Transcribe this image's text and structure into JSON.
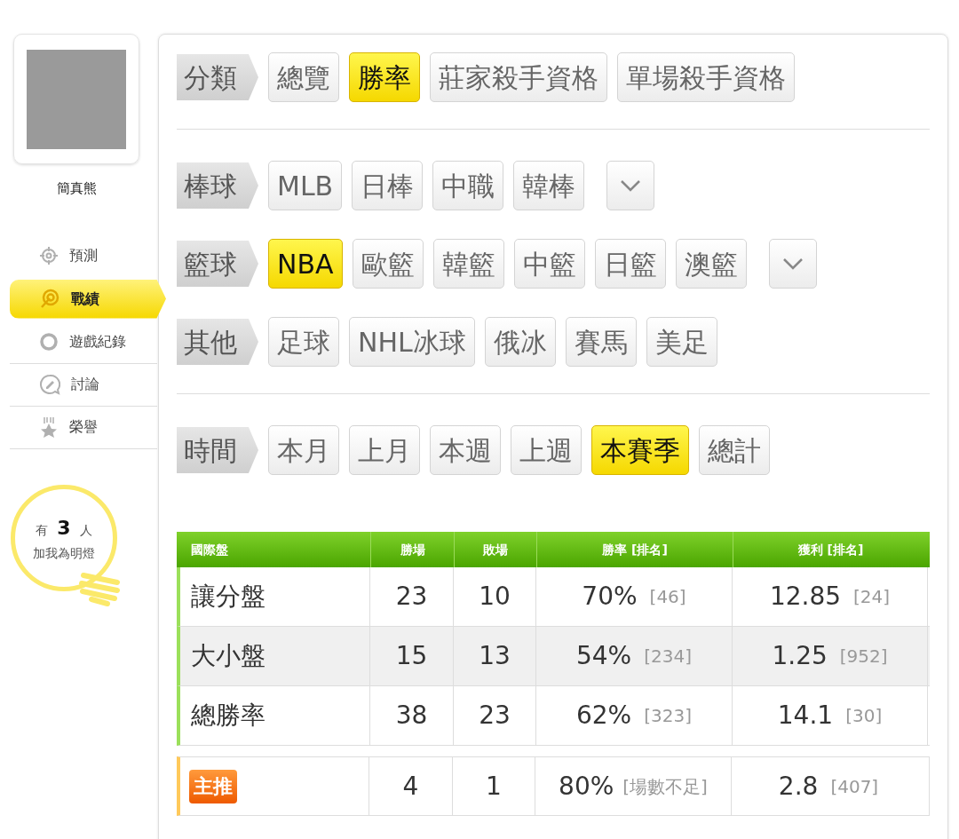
{
  "profile": {
    "name": "簡真熊"
  },
  "nav": [
    {
      "label": "預測",
      "kind": "crosshair",
      "selected": false
    },
    {
      "label": "戰績",
      "kind": "target",
      "selected": true
    },
    {
      "label": "遊戲紀錄",
      "kind": "ring",
      "selected": false
    },
    {
      "label": "討論",
      "kind": "chat",
      "selected": false
    },
    {
      "label": "榮譽",
      "kind": "medal",
      "selected": false
    }
  ],
  "fans": {
    "prefix": "有",
    "count": "3",
    "suffix": "人",
    "text": "加我為明燈"
  },
  "filter_sections": [
    {
      "rows": [
        {
          "label": "分類",
          "has_dropdown": false,
          "options": [
            {
              "label": "總覽",
              "selected": false
            },
            {
              "label": "勝率",
              "selected": true
            },
            {
              "label": "莊家殺手資格",
              "selected": false
            },
            {
              "label": "單場殺手資格",
              "selected": false
            }
          ]
        }
      ]
    },
    {
      "rows": [
        {
          "label": "棒球",
          "has_dropdown": true,
          "options": [
            {
              "label": "MLB",
              "selected": false
            },
            {
              "label": "日棒",
              "selected": false
            },
            {
              "label": "中職",
              "selected": false
            },
            {
              "label": "韓棒",
              "selected": false
            }
          ]
        },
        {
          "label": "籃球",
          "has_dropdown": true,
          "options": [
            {
              "label": "NBA",
              "selected": true
            },
            {
              "label": "歐籃",
              "selected": false
            },
            {
              "label": "韓籃",
              "selected": false
            },
            {
              "label": "中籃",
              "selected": false
            },
            {
              "label": "日籃",
              "selected": false
            },
            {
              "label": "澳籃",
              "selected": false
            }
          ]
        },
        {
          "label": "其他",
          "has_dropdown": false,
          "options": [
            {
              "label": "足球",
              "selected": false
            },
            {
              "label": "NHL冰球",
              "selected": false
            },
            {
              "label": "俄冰",
              "selected": false
            },
            {
              "label": "賽馬",
              "selected": false
            },
            {
              "label": "美足",
              "selected": false
            }
          ]
        }
      ]
    },
    {
      "rows": [
        {
          "label": "時間",
          "has_dropdown": false,
          "options": [
            {
              "label": "本月",
              "selected": false
            },
            {
              "label": "上月",
              "selected": false
            },
            {
              "label": "本週",
              "selected": false
            },
            {
              "label": "上週",
              "selected": false
            },
            {
              "label": "本賽季",
              "selected": true
            },
            {
              "label": "總計",
              "selected": false
            }
          ]
        }
      ]
    }
  ],
  "table": {
    "columns": [
      "國際盤",
      "勝場",
      "敗場",
      "勝率 [排名]",
      "獲利 [排名]"
    ],
    "rows": [
      {
        "label": "讓分盤",
        "wins": "23",
        "losses": "10",
        "rate": "70%",
        "rate_rank": "[46]",
        "profit": "12.85",
        "profit_rank": "[24]"
      },
      {
        "label": "大小盤",
        "wins": "15",
        "losses": "13",
        "rate": "54%",
        "rate_rank": "[234]",
        "profit": "1.25",
        "profit_rank": "[952]"
      },
      {
        "label": "總勝率",
        "wins": "38",
        "losses": "23",
        "rate": "62%",
        "rate_rank": "[323]",
        "profit": "14.1",
        "profit_rank": "[30]"
      }
    ],
    "featured": {
      "badge": "主推",
      "wins": "4",
      "losses": "1",
      "rate": "80%",
      "rate_rank": "[場數不足]",
      "profit": "2.8",
      "profit_rank": "[407]"
    }
  }
}
